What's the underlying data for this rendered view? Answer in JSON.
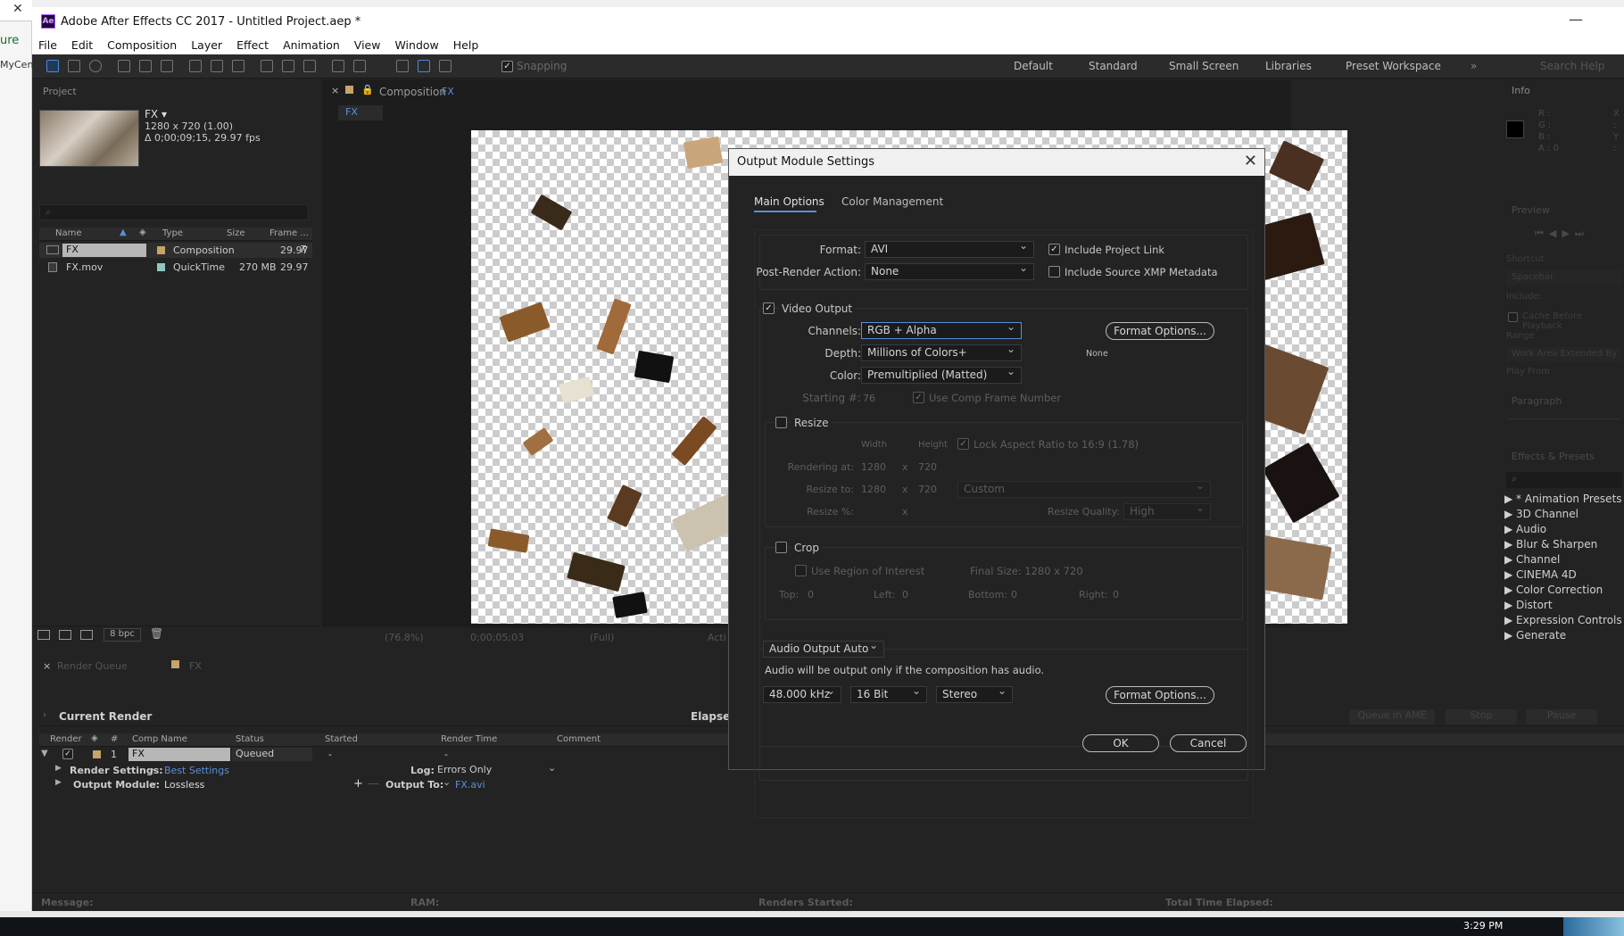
{
  "window": {
    "title": "Adobe After Effects CC 2017 - Untitled Project.aep *"
  },
  "background": {
    "fragment1": "ure",
    "fragment2": "MyCen"
  },
  "menu": [
    "File",
    "Edit",
    "Composition",
    "Layer",
    "Effect",
    "Animation",
    "View",
    "Window",
    "Help"
  ],
  "toolbar": {
    "snapping": "Snapping",
    "workspaces": [
      "Default",
      "Standard",
      "Small Screen",
      "Libraries",
      "Preset Workspace"
    ],
    "search_placeholder": "Search Help"
  },
  "project": {
    "title": "Project",
    "item_name": "FX ▾",
    "item_size": "1280 x 720 (1.00)",
    "item_duration": "Δ 0;00;09;15, 29.97 fps",
    "columns": [
      "Name",
      "Type",
      "Size",
      "Frame ..."
    ],
    "rows": [
      {
        "name": "FX",
        "type": "Composition",
        "size": "",
        "frame": "29.97"
      },
      {
        "name": "FX.mov",
        "type": "QuickTime",
        "size": "270 MB",
        "frame": "29.97"
      }
    ],
    "bpc": "8 bpc"
  },
  "composition": {
    "tab_prefix": "Composition",
    "tab_name": "FX",
    "subtab": "FX",
    "zoom": "(76.8%)",
    "timecode": "0;00;05;03",
    "resolution": "(Full)",
    "active": "Acti"
  },
  "info_panel": {
    "title": "Info",
    "rgb": [
      "R :",
      "G :",
      "B :",
      "A : 0"
    ],
    "xy": [
      "X :",
      "Y :"
    ]
  },
  "preview_panel": {
    "title": "Preview",
    "shortcut_label": "Shortcut",
    "shortcut_value": "Spacebar",
    "include_label": "Include:",
    "cache": "Cache Before Playback",
    "range_label": "Range",
    "range_value": "Work Area Extended By",
    "play_from": "Play From"
  },
  "paragraph_panel": {
    "title": "Paragraph"
  },
  "effects_panel": {
    "title": "Effects & Presets",
    "items": [
      "* Animation Presets",
      "3D Channel",
      "Audio",
      "Blur & Sharpen",
      "Channel",
      "CINEMA 4D",
      "Color Correction",
      "Distort",
      "Expression Controls",
      "Generate"
    ]
  },
  "render_queue": {
    "tab": "Render Queue",
    "tab2": "FX",
    "current_render": "Current Render",
    "elapsed": "Elapsed:",
    "buttons": [
      "Queue in AME",
      "Stop",
      "Pause"
    ],
    "columns": [
      "Render",
      "#",
      "Comp Name",
      "Status",
      "Started",
      "Render Time",
      "Comment"
    ],
    "row": {
      "num": "1",
      "comp": "FX",
      "status": "Queued",
      "started": "-",
      "render_time": "-"
    },
    "render_settings_label": "Render Settings:",
    "render_settings_value": "Best Settings",
    "log_label": "Log:",
    "log_value": "Errors Only",
    "output_module_label": "Output Module:",
    "output_module_value": "Lossless",
    "output_to_label": "Output To:",
    "output_to_value": "FX.avi",
    "status_bar": {
      "message": "Message:",
      "ram": "RAM:",
      "renders_started": "Renders Started:",
      "total_time": "Total Time Elapsed:"
    }
  },
  "taskbar": {
    "time": "3:29 PM"
  },
  "dialog": {
    "title": "Output Module Settings",
    "tabs": [
      "Main Options",
      "Color Management"
    ],
    "format_label": "Format:",
    "format_value": "AVI",
    "include_project_link": "Include Project Link",
    "post_render_label": "Post-Render Action:",
    "post_render_value": "None",
    "include_xmp": "Include Source XMP Metadata",
    "video_output": "Video Output",
    "channels_label": "Channels:",
    "channels_value": "RGB + Alpha",
    "format_options": "Format Options...",
    "depth_label": "Depth:",
    "depth_value": "Millions of Colors+",
    "none_text": "None",
    "color_label": "Color:",
    "color_value": "Premultiplied (Matted)",
    "starting_label": "Starting #:",
    "starting_value": "76",
    "use_comp_frame": "Use Comp Frame Number",
    "resize": "Resize",
    "width_label": "Width",
    "height_label": "Height",
    "lock_aspect": "Lock Aspect Ratio to 16:9 (1.78)",
    "rendering_at_label": "Rendering at:",
    "rendering_w": "1280",
    "rendering_h": "720",
    "resize_to_label": "Resize to:",
    "resize_to_w": "1280",
    "resize_to_h": "720",
    "resize_preset": "Custom",
    "resize_pct_label": "Resize %:",
    "x_sep": "x",
    "resize_quality_label": "Resize Quality:",
    "resize_quality_value": "High",
    "crop": "Crop",
    "use_roi": "Use Region of Interest",
    "final_size": "Final Size: 1280 x 720",
    "top_label": "Top:",
    "top_value": "0",
    "left_label": "Left:",
    "left_value": "0",
    "bottom_label": "Bottom:",
    "bottom_value": "0",
    "right_label": "Right:",
    "right_value": "0",
    "audio_output": "Audio Output Auto",
    "audio_note": "Audio will be output only if the composition has audio.",
    "sample_rate": "48.000 kHz",
    "bit_depth": "16 Bit",
    "channels_audio": "Stereo",
    "audio_format_options": "Format Options...",
    "ok": "OK",
    "cancel": "Cancel"
  }
}
